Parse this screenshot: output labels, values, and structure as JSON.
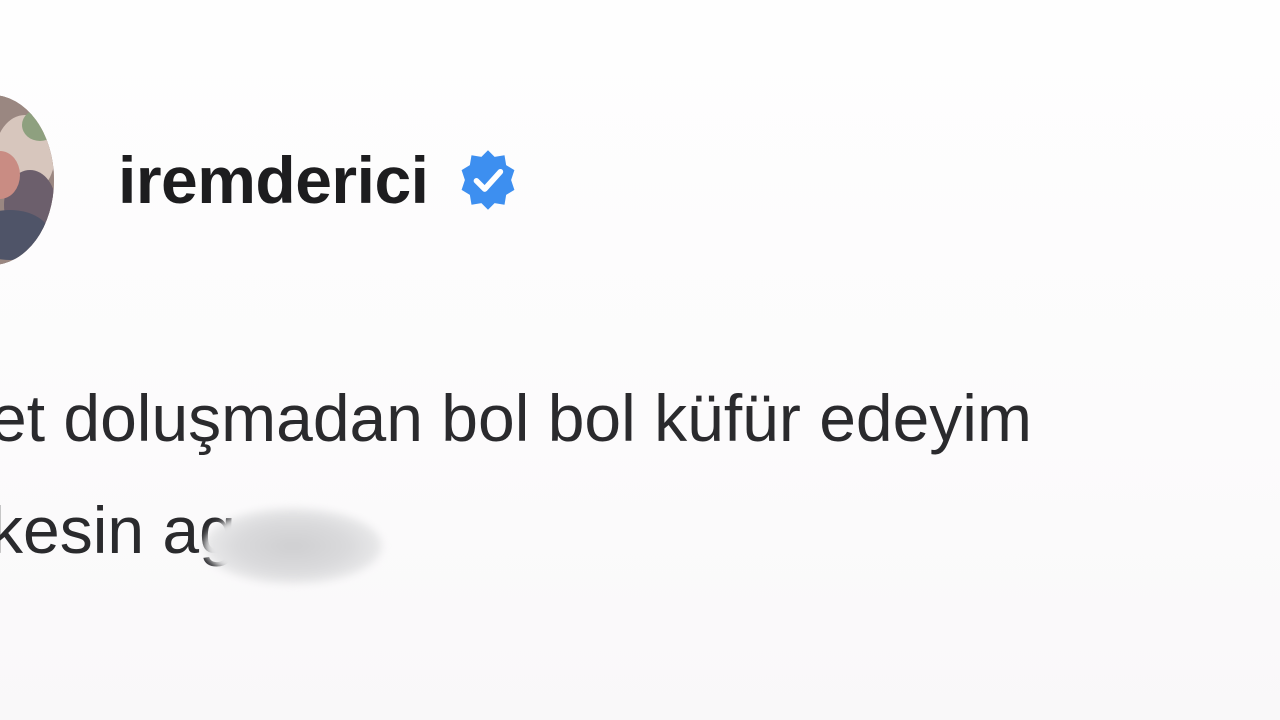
{
  "post": {
    "username": "iremderici",
    "verified_badge_color": "#3897f0",
    "caption_lines": [
      "et doluşmadan bol bol küfür edeyim",
      "kesin ag"
    ]
  },
  "icons": {
    "verified": "verified-check-icon",
    "avatar": "profile-avatar"
  }
}
